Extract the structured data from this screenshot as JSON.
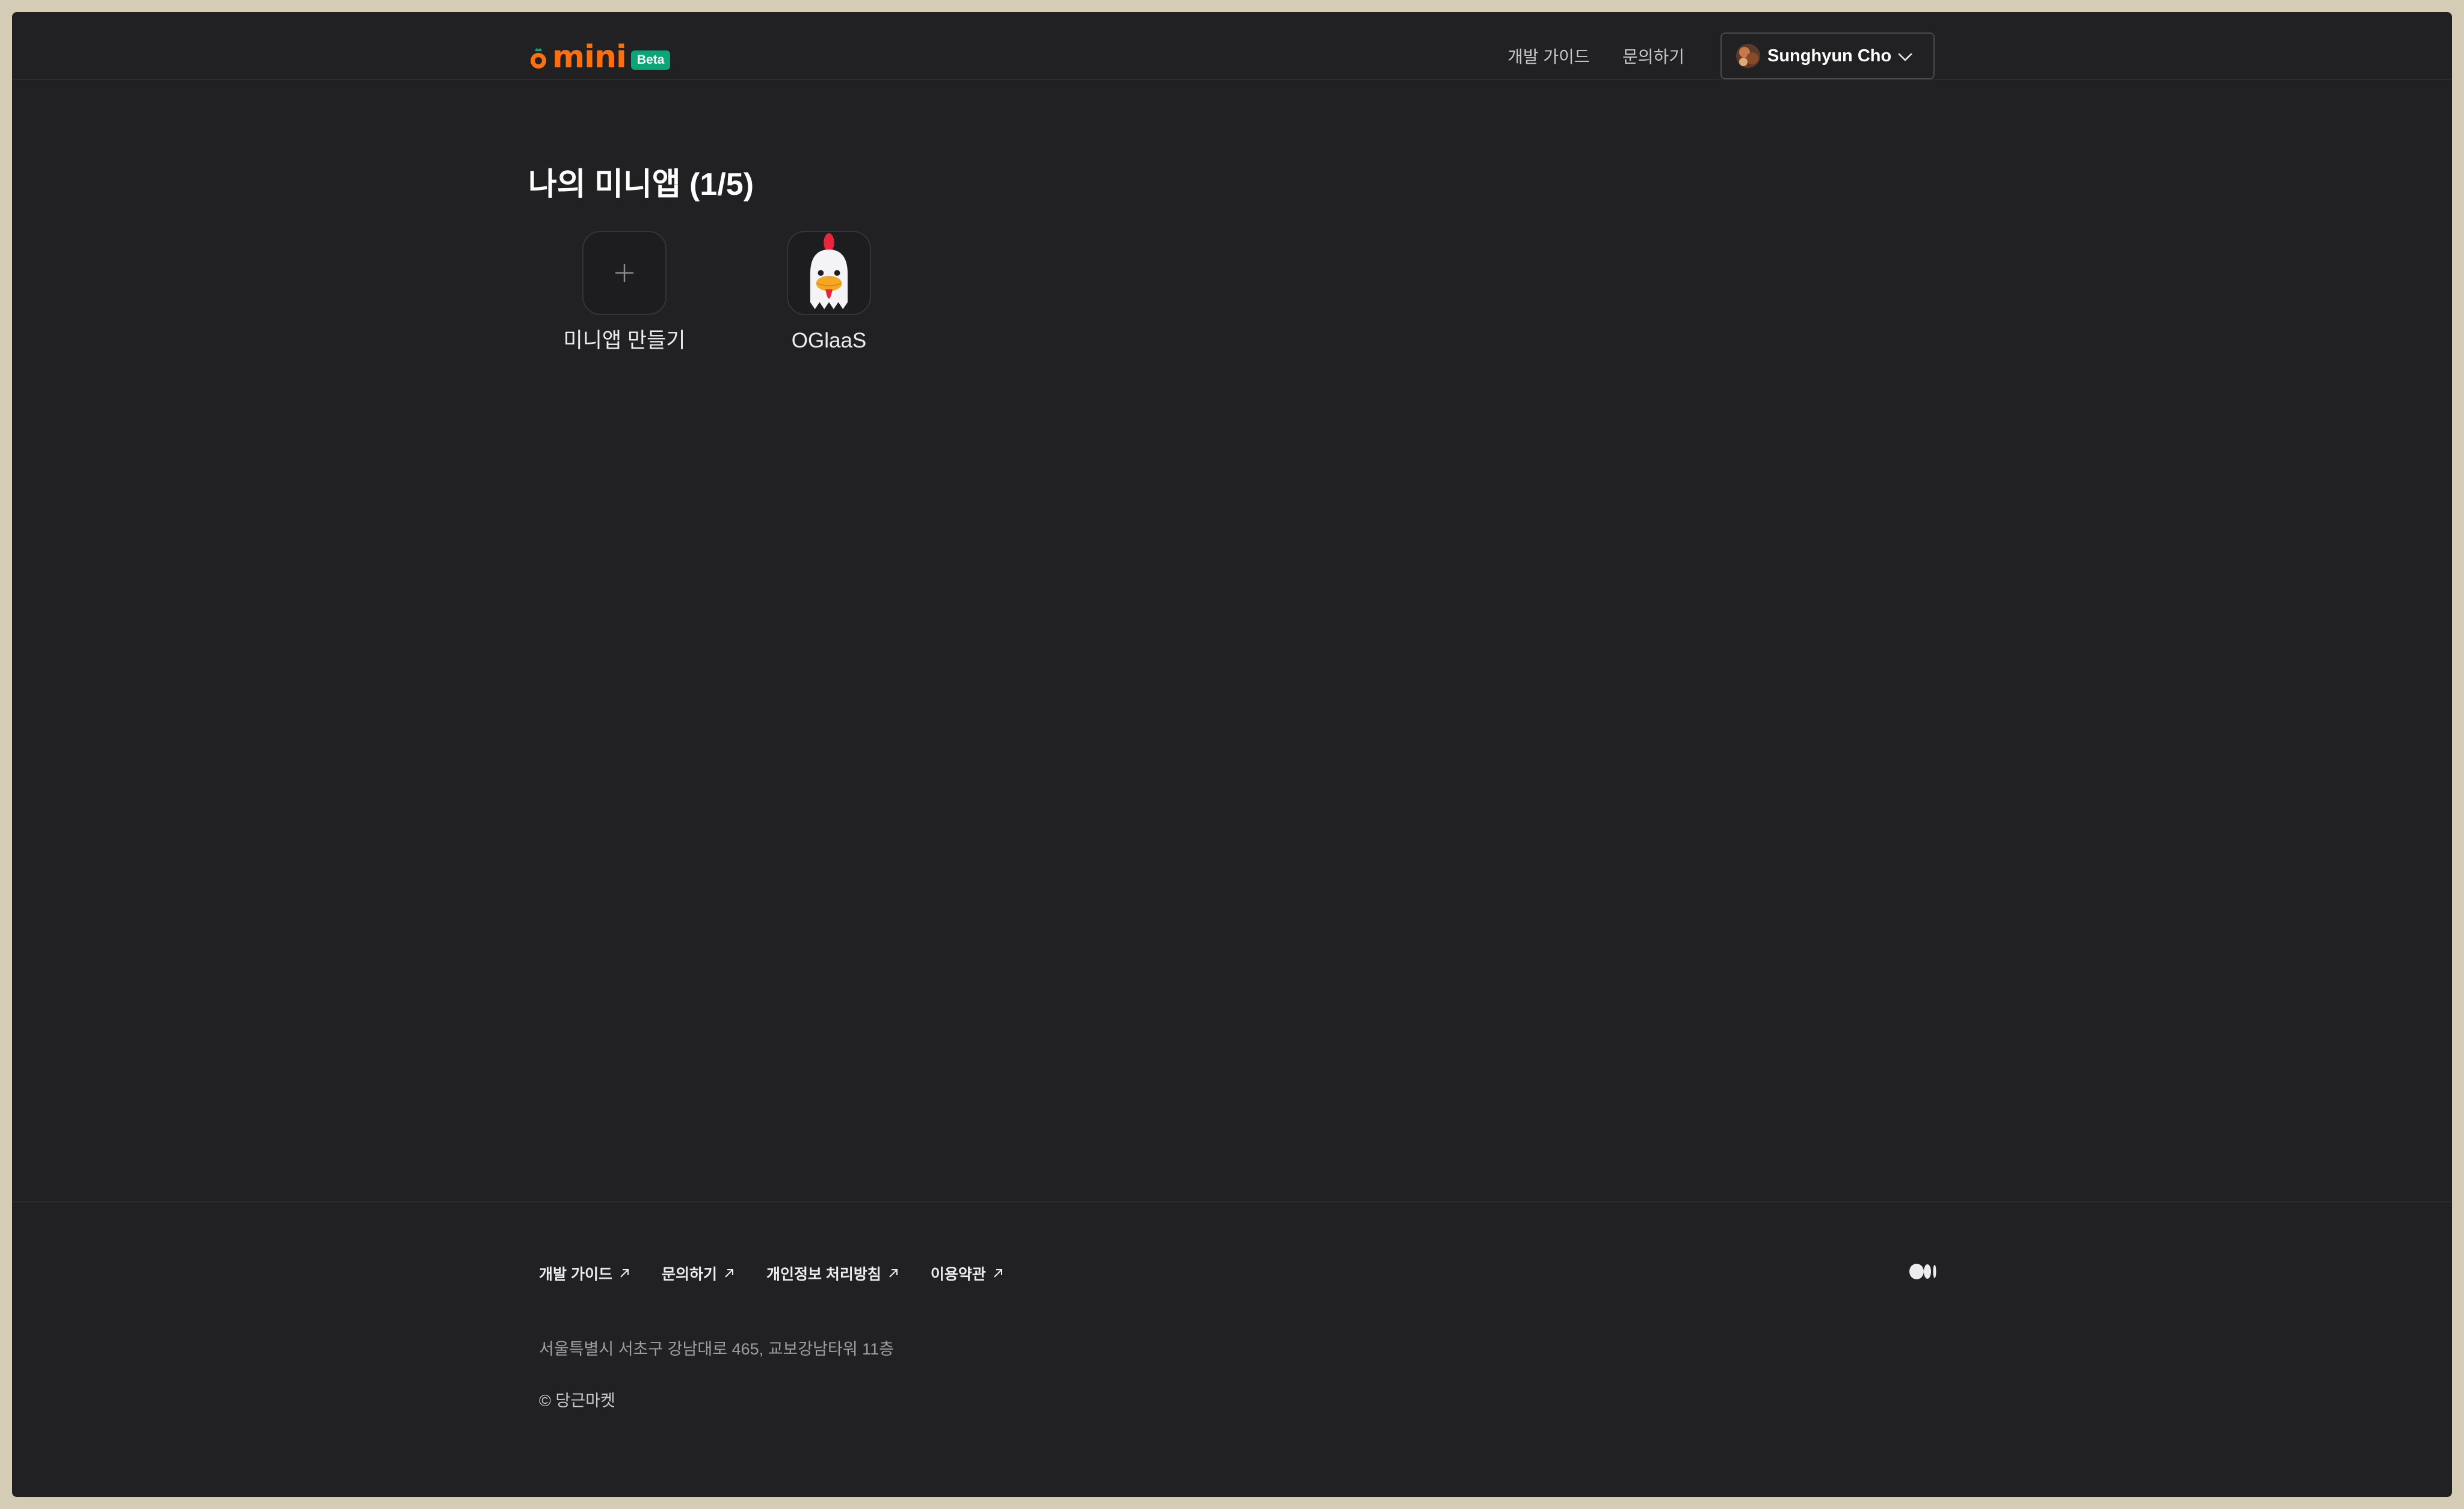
{
  "header": {
    "logo_text": "mini",
    "beta_badge": "Beta",
    "nav": {
      "guide": "개발 가이드",
      "contact": "문의하기"
    },
    "user": {
      "name": "Sunghyun Cho"
    }
  },
  "main": {
    "title": "나의 미니앱 (1/5)",
    "apps": [
      {
        "label": "미니앱 만들기",
        "icon": "plus-icon"
      },
      {
        "label": "OGlaaS",
        "icon": "chicken-icon"
      }
    ]
  },
  "footer": {
    "links": [
      {
        "label": "개발 가이드"
      },
      {
        "label": "문의하기"
      },
      {
        "label": "개인정보 처리방침"
      },
      {
        "label": "이용약관"
      }
    ],
    "address": "서울특별시 서초구 강남대로 465, 교보강남타워 11층",
    "copyright": "© 당근마켓"
  },
  "colors": {
    "background": "#212123",
    "brand_orange": "#ff6f0f",
    "beta_green": "#0ba678"
  }
}
